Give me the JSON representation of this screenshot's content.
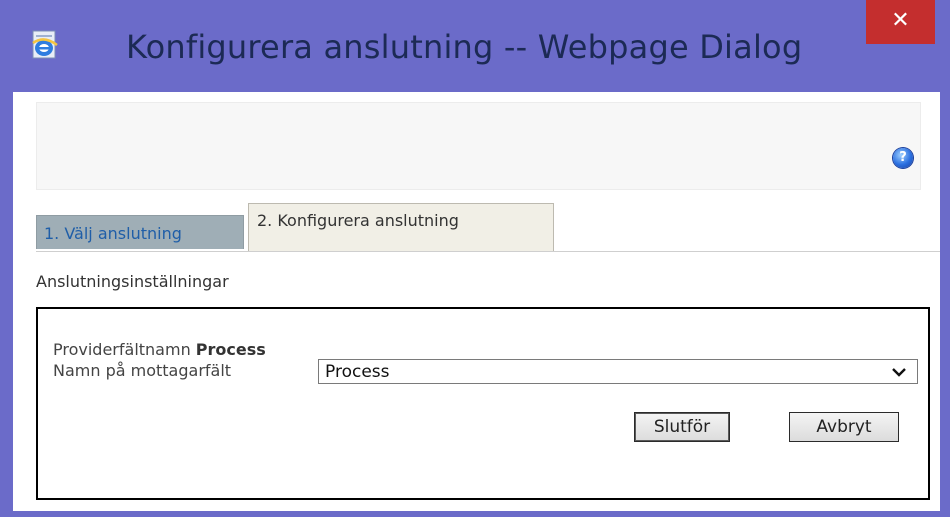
{
  "window": {
    "title": "Konfigurera anslutning -- Webpage Dialog",
    "close_glyph": "✕",
    "app_icon": "internet-explorer-icon"
  },
  "header": {
    "help_glyph": "?"
  },
  "tabs": [
    {
      "label": "1. Välj anslutning",
      "active": false
    },
    {
      "label": "2. Konfigurera anslutning",
      "active": true
    }
  ],
  "section_label": "Anslutningsinställningar",
  "form": {
    "provider_label": "Providerfältnamn",
    "provider_value": "Process",
    "consumer_label": "Namn på mottagarfält",
    "consumer_selected": "Process"
  },
  "buttons": {
    "finish": "Slutför",
    "cancel": "Avbryt"
  },
  "colors": {
    "frame": "#6b6bc9",
    "close": "#c42e2e",
    "inactive_tab": "#9faeb6",
    "active_tab": "#f1efe6",
    "link_blue": "#1f5ea8"
  }
}
